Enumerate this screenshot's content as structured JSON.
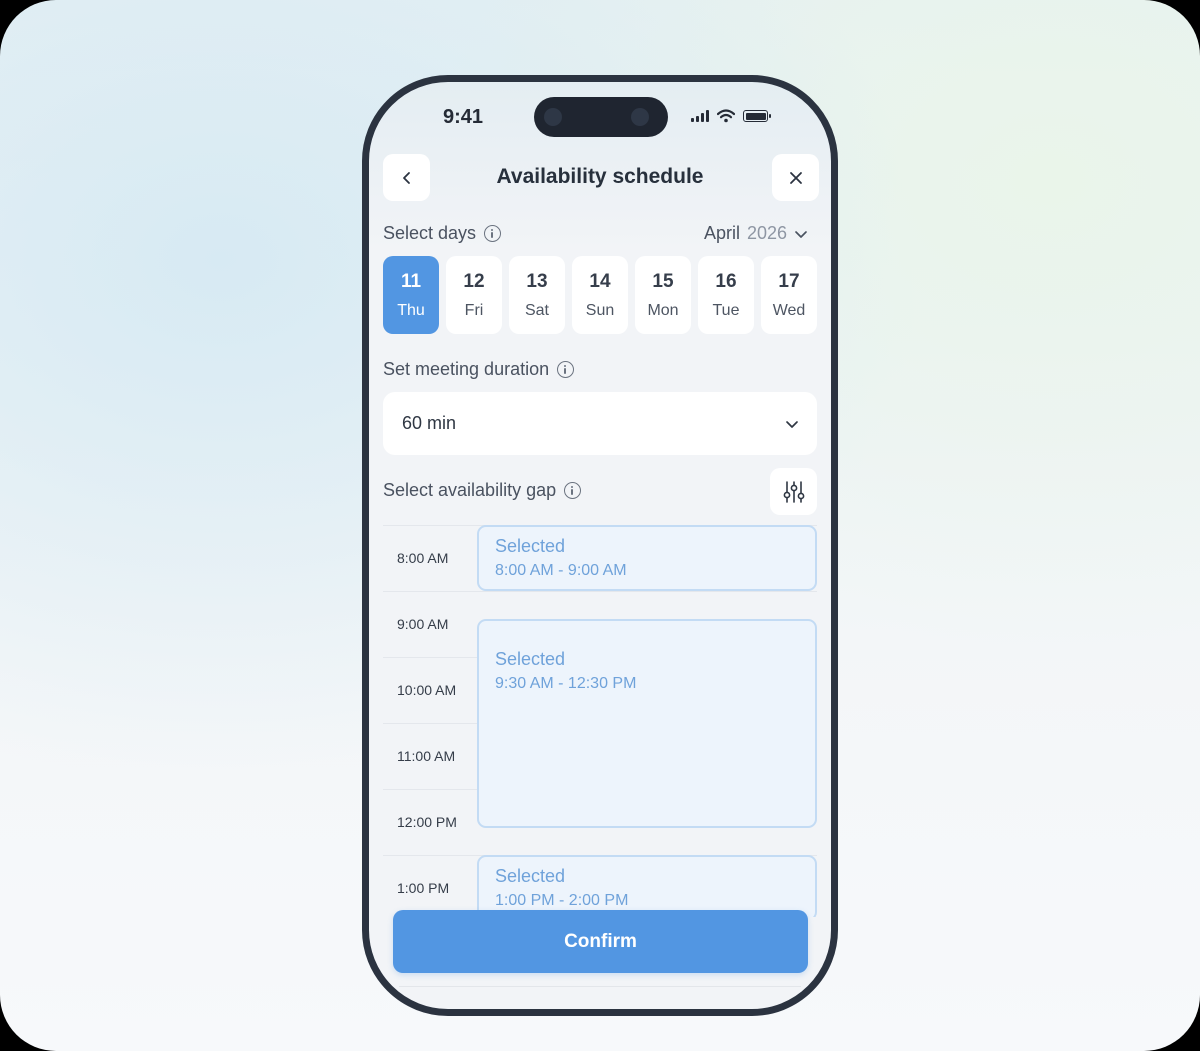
{
  "status_bar": {
    "time": "9:41"
  },
  "header": {
    "title": "Availability schedule"
  },
  "select_days": {
    "label": "Select days",
    "month": "April",
    "year": "2026",
    "days": [
      {
        "num": "11",
        "name": "Thu",
        "selected": true
      },
      {
        "num": "12",
        "name": "Fri",
        "selected": false
      },
      {
        "num": "13",
        "name": "Sat",
        "selected": false
      },
      {
        "num": "14",
        "name": "Sun",
        "selected": false
      },
      {
        "num": "15",
        "name": "Mon",
        "selected": false
      },
      {
        "num": "16",
        "name": "Tue",
        "selected": false
      },
      {
        "num": "17",
        "name": "Wed",
        "selected": false
      }
    ]
  },
  "duration": {
    "label": "Set meeting duration",
    "value": "60 min"
  },
  "gap": {
    "label": "Select availability gap",
    "times": [
      "8:00 AM",
      "9:00 AM",
      "10:00 AM",
      "11:00 AM",
      "12:00 PM",
      "1:00 PM"
    ],
    "slots": [
      {
        "label": "Selected",
        "range": "8:00 AM - 9:00 AM"
      },
      {
        "label": "Selected",
        "range": "9:30 AM - 12:30 PM"
      },
      {
        "label": "Selected",
        "range": "1:00 PM - 2:00 PM"
      }
    ]
  },
  "actions": {
    "confirm": "Confirm"
  },
  "colors": {
    "accent": "#5296e2",
    "slot_bg": "#edf4fc",
    "slot_border": "#c3dbf4",
    "slot_text": "#6fa2da"
  }
}
